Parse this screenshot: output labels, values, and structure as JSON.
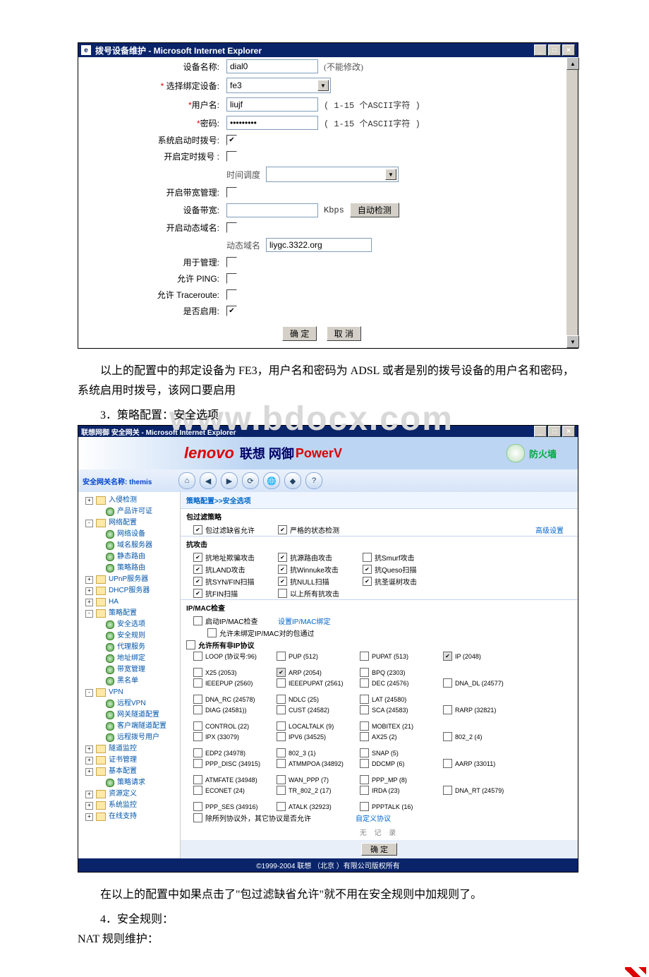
{
  "window1": {
    "title": "拨号设备维护 - Microsoft Internet Explorer",
    "icon_name": "ie-icon",
    "form": {
      "device_name": {
        "label": "设备名称:",
        "value": "dial0",
        "hint": "(不能修改)"
      },
      "bind_device": {
        "label": "选择绑定设备:",
        "star": "*",
        "value": "fe3"
      },
      "username": {
        "label": "用户名:",
        "star": "*",
        "value": "liujf",
        "hint": "( 1-15 个ASCII字符 )"
      },
      "password": {
        "label": "密码:",
        "star": "*",
        "value": "*********",
        "hint": "( 1-15 个ASCII字符 )"
      },
      "dial_on_boot": {
        "label": "系统启动时拨号:",
        "checked": true
      },
      "timed_dial": {
        "label": "开启定时拨号  :",
        "checked": false,
        "subLabel": "时间调度"
      },
      "bandwidth_mgmt": {
        "label": "开启带宽管理:",
        "checked": false
      },
      "device_bw": {
        "label": "设备带宽:",
        "value": "",
        "unit": "Kbps",
        "btn": "自动检测"
      },
      "ddns": {
        "label": "开启动态域名:",
        "checked": false,
        "subLabel": "动态域名",
        "domain": "liygc.3322.org"
      },
      "for_manage": {
        "label": "用于管理:",
        "checked": false
      },
      "allow_ping": {
        "label": "允许 PING:",
        "checked": false
      },
      "allow_trace": {
        "label": "允许 Traceroute:",
        "checked": false
      },
      "enabled": {
        "label": "是否启用:",
        "checked": true
      }
    },
    "buttons": {
      "ok": "确 定",
      "cancel": "取 消"
    }
  },
  "text": {
    "para1": "以上的配置中的邦定设备为 FE3，用户名和密码为 ADSL 或者是别的拨号设备的用户名和密码，系统启用时拨号，该网口要启用",
    "item3": "3．策略配置：安全选项",
    "para2": "在以上的配置中如果点击了\"包过滤缺省允许\"就不用在安全规则中加规则了。",
    "item4": "4．安全规则：",
    "item5": "NAT 规则维护：",
    "watermark": "www.bdocx.com"
  },
  "window2": {
    "title": "联想网御 安全网关 - Microsoft Internet Explorer",
    "topLeft": "安全网关名称: themis",
    "banner": {
      "logo": "lenovo",
      "cn": "联想 网御",
      "prod": "PowerV",
      "fw": "防火墙"
    },
    "crumb": "策略配置>>安全选项",
    "filter": {
      "section": "包过滤策略",
      "allowDefault": {
        "checked": true,
        "label": "包过滤缺省允许"
      },
      "strictState": {
        "checked": true,
        "label": "严格的状态检测"
      },
      "advanced": "高级设置"
    },
    "antiattack": {
      "section": "抗攻击",
      "items": [
        [
          {
            "c": true,
            "t": "抗地址欺骗攻击"
          },
          {
            "c": true,
            "t": "抗源路由攻击"
          },
          {
            "c": false,
            "t": "抗Smurf攻击"
          }
        ],
        [
          {
            "c": true,
            "t": "抗LAND攻击"
          },
          {
            "c": true,
            "t": "抗Winnuke攻击"
          },
          {
            "c": true,
            "t": "抗Queso扫描"
          }
        ],
        [
          {
            "c": true,
            "t": "抗SYN/FIN扫描"
          },
          {
            "c": true,
            "t": "抗NULL扫描"
          },
          {
            "c": true,
            "t": "抗圣诞树攻击"
          }
        ],
        [
          {
            "c": true,
            "t": "抗FIN扫描"
          },
          {
            "c": false,
            "t": "以上所有抗攻击"
          }
        ]
      ]
    },
    "ipmac": {
      "section": "IP/MAC检查",
      "enable": {
        "c": false,
        "t": "启动IP/MAC检查"
      },
      "setLink": "设置IP/MAC绑定",
      "pass": {
        "c": false,
        "t": "允许未绑定IP/MAC对的包通过"
      }
    },
    "nonip": {
      "header": {
        "c": false,
        "t": "允许所有非IP协议"
      },
      "rows": [
        [
          {
            "t": "LOOP (协议号:96)",
            "c": false
          },
          {
            "t": "PUP (512)",
            "c": false
          },
          {
            "t": "PUPAT (513)",
            "c": false
          },
          {
            "t": "IP (2048)",
            "c": true,
            "d": true
          },
          {
            "t": "X25 (2053)",
            "c": false
          },
          {
            "t": "ARP (2054)",
            "c": true,
            "d": true
          },
          {
            "t": "BPQ (2303)",
            "c": false
          }
        ],
        [
          {
            "t": "IEEEPUP (2560)",
            "c": false
          },
          {
            "t": "IEEEPUPAT (2561)",
            "c": false
          },
          {
            "t": "DEC (24576)",
            "c": false
          },
          {
            "t": "DNA_DL (24577)",
            "c": false
          },
          {
            "t": "DNA_RC (24578)",
            "c": false
          },
          {
            "t": "NDLC  (25)",
            "c": false
          },
          {
            "t": "LAT (24580)",
            "c": false
          }
        ],
        [
          {
            "t": "DIAG (24581))",
            "c": false
          },
          {
            "t": "CUST (24582)",
            "c": false
          },
          {
            "t": "SCA (24583)",
            "c": false
          },
          {
            "t": "RARP (32821)",
            "c": false
          },
          {
            "t": "CONTROL (22)",
            "c": false
          },
          {
            "t": "LOCALTALK (9)",
            "c": false
          },
          {
            "t": "MOBITEX (21)",
            "c": false
          }
        ],
        [
          {
            "t": "IPX (33079)",
            "c": false
          },
          {
            "t": "IPV6 (34525)",
            "c": false
          },
          {
            "t": "AX25 (2)",
            "c": false
          },
          {
            "t": "802_2 (4)",
            "c": false
          },
          {
            "t": "EDP2 (34978)",
            "c": false
          },
          {
            "t": "802_3 (1)",
            "c": false
          },
          {
            "t": "SNAP (5)",
            "c": false
          }
        ],
        [
          {
            "t": "PPP_DISC (34915)",
            "c": false
          },
          {
            "t": "ATMMPOA (34892)",
            "c": false
          },
          {
            "t": "DDCMP (6)",
            "c": false
          },
          {
            "t": "AARP (33011)",
            "c": false
          },
          {
            "t": "ATMFATE (34948)",
            "c": false
          },
          {
            "t": "WAN_PPP (7)",
            "c": false
          },
          {
            "t": "PPP_MP (8)",
            "c": false
          }
        ],
        [
          {
            "t": "ECONET (24)",
            "c": false
          },
          {
            "t": "TR_802_2 (17)",
            "c": false
          },
          {
            "t": "IRDA (23)",
            "c": false
          },
          {
            "t": "DNA_RT (24579)",
            "c": false
          },
          {
            "t": "PPP_SES (34916)",
            "c": false
          },
          {
            "t": "ATALK (32923)",
            "c": false
          },
          {
            "t": "PPPTALK (16)",
            "c": false
          }
        ]
      ],
      "except": {
        "c": false,
        "t": "除所列协议外，其它协议是否允许"
      },
      "customLink": "自定义协议",
      "noRecord": "无  记  录",
      "ok": "确 定"
    },
    "footer": "©1999-2004 联想 （北京 ）有限公司版权所有",
    "tree": [
      {
        "l": 1,
        "pm": "+",
        "type": "fld",
        "t": "入侵检测"
      },
      {
        "l": 2,
        "type": "leaf",
        "t": "产品许可证"
      },
      {
        "l": 1,
        "pm": "-",
        "type": "fld",
        "t": "网络配置"
      },
      {
        "l": 2,
        "type": "leaf",
        "t": "网络设备"
      },
      {
        "l": 2,
        "type": "leaf",
        "t": "域名服务器"
      },
      {
        "l": 2,
        "type": "leaf",
        "t": "静态路由"
      },
      {
        "l": 2,
        "type": "leaf",
        "t": "策略路由"
      },
      {
        "l": 1,
        "pm": "+",
        "type": "fld",
        "t": "UPnP服务器"
      },
      {
        "l": 1,
        "pm": "+",
        "type": "fld",
        "t": "DHCP服务器"
      },
      {
        "l": 1,
        "pm": "+",
        "type": "fld",
        "t": "HA"
      },
      {
        "l": 1,
        "pm": "-",
        "type": "fld",
        "t": "策略配置"
      },
      {
        "l": 2,
        "type": "leaf",
        "t": "安全选项"
      },
      {
        "l": 2,
        "type": "leaf",
        "t": "安全规则"
      },
      {
        "l": 2,
        "type": "leaf",
        "t": "代理服务"
      },
      {
        "l": 2,
        "type": "leaf",
        "t": "地址绑定"
      },
      {
        "l": 2,
        "type": "leaf",
        "t": "带宽管理"
      },
      {
        "l": 2,
        "type": "leaf",
        "t": "黑名单"
      },
      {
        "l": 1,
        "pm": "-",
        "type": "fld",
        "t": "VPN"
      },
      {
        "l": 2,
        "type": "leaf",
        "t": "远程VPN"
      },
      {
        "l": 2,
        "type": "leaf",
        "t": "网关隧道配置"
      },
      {
        "l": 2,
        "type": "leaf",
        "t": "客户端隧道配置"
      },
      {
        "l": 2,
        "type": "leaf",
        "t": "远程拨号用户"
      },
      {
        "l": 1,
        "pm": "+",
        "type": "fld",
        "t": "隧道监控"
      },
      {
        "l": 1,
        "pm": "+",
        "type": "fld",
        "t": "证书管理"
      },
      {
        "l": 1,
        "pm": "+",
        "type": "fld",
        "t": "基本配置"
      },
      {
        "l": 2,
        "type": "leaf",
        "t": "策略请求"
      },
      {
        "l": 1,
        "pm": "+",
        "type": "fld",
        "t": "资源定义"
      },
      {
        "l": 1,
        "pm": "+",
        "type": "fld",
        "t": "系统监控"
      },
      {
        "l": 1,
        "pm": "+",
        "type": "fld",
        "t": "在线支持"
      }
    ]
  }
}
